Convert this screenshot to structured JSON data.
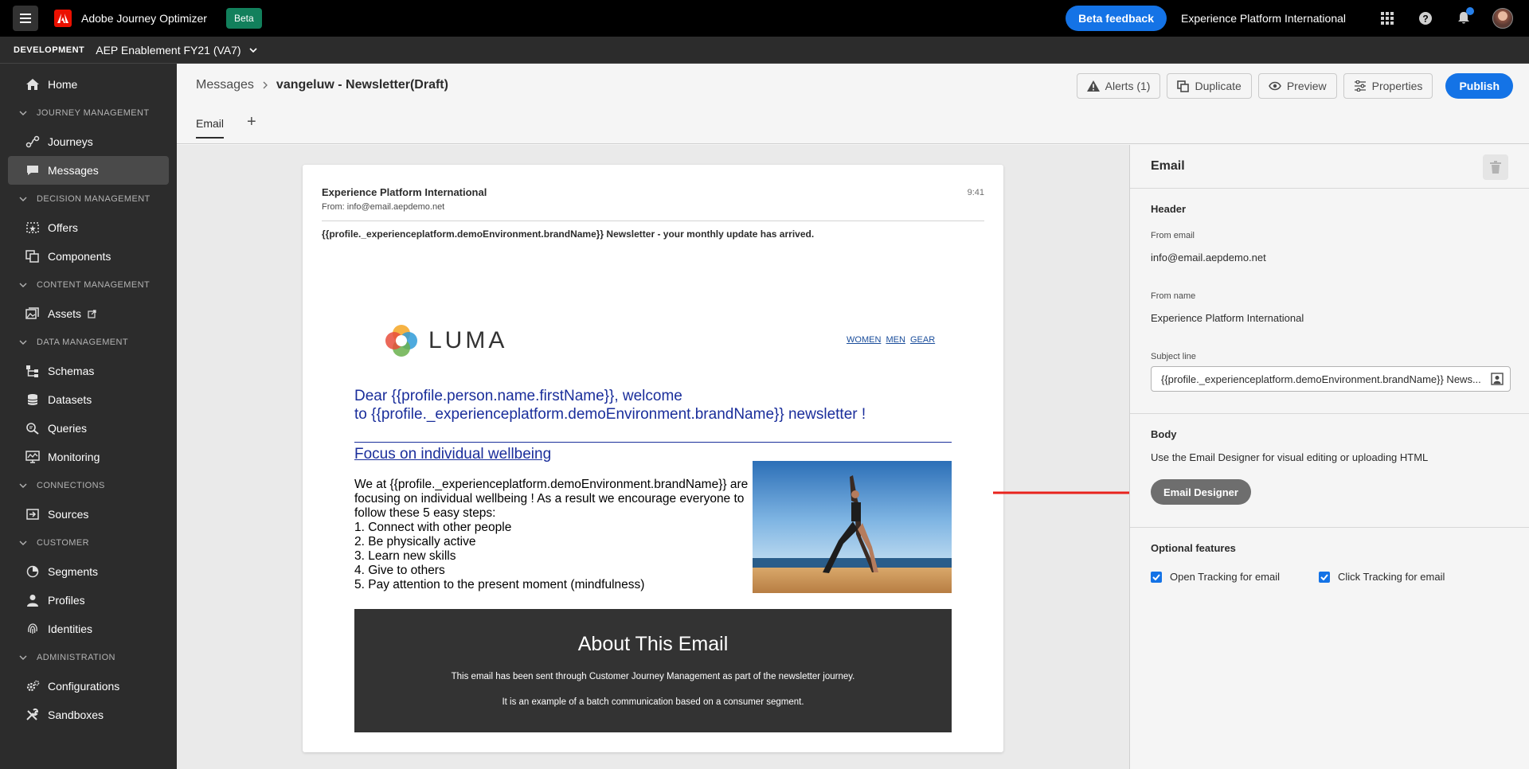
{
  "topbar": {
    "app_title": "Adobe Journey Optimizer",
    "beta_badge": "Beta",
    "beta_feedback": "Beta feedback",
    "org_name": "Experience Platform International"
  },
  "sandbox": {
    "env_label": "DEVELOPMENT",
    "name": "AEP Enablement FY21 (VA7)"
  },
  "sidebar": {
    "home": "Home",
    "journey_management": "JOURNEY MANAGEMENT",
    "journeys": "Journeys",
    "messages": "Messages",
    "decision_management": "DECISION MANAGEMENT",
    "offers": "Offers",
    "components": "Components",
    "content_management": "CONTENT MANAGEMENT",
    "assets": "Assets",
    "data_management": "DATA MANAGEMENT",
    "schemas": "Schemas",
    "datasets": "Datasets",
    "queries": "Queries",
    "monitoring": "Monitoring",
    "connections": "CONNECTIONS",
    "sources": "Sources",
    "customer": "CUSTOMER",
    "segments": "Segments",
    "profiles": "Profiles",
    "identities": "Identities",
    "administration": "ADMINISTRATION",
    "configurations": "Configurations",
    "sandboxes": "Sandboxes"
  },
  "header": {
    "breadcrumb_parent": "Messages",
    "breadcrumb_current": "vangeluw - Newsletter(Draft)",
    "tab_email": "Email",
    "alerts": "Alerts (1)",
    "duplicate": "Duplicate",
    "preview": "Preview",
    "properties": "Properties",
    "publish": "Publish"
  },
  "email_preview": {
    "sender": "Experience Platform International",
    "from": "From: info@email.aepdemo.net",
    "time": "9:41",
    "subject": "{{profile._experienceplatform.demoEnvironment.brandName}} Newsletter - your monthly update has arrived.",
    "logo_text": "LUMA",
    "nav_women": "WOMEN",
    "nav_men": "MEN",
    "nav_gear": "GEAR",
    "dear_line1": "Dear {{profile.person.name.firstName}}, welcome",
    "dear_line2": "to {{profile._experienceplatform.demoEnvironment.brandName}} newsletter !",
    "focus_heading": "Focus on individual wellbeing ",
    "body_intro": "We at {{profile._experienceplatform.demoEnvironment.brandName}} are focusing on individual wellbeing ! As a result we encourage everyone to follow these 5 easy steps:",
    "steps": [
      "1. Connect with other people",
      "2. Be physically active",
      "3. Learn new skills",
      "4. Give to others",
      "5. Pay attention to the present moment (mindfulness)"
    ],
    "about_title": "About This Email",
    "about_line1": "This email has been sent through Customer Journey Management as part of the newsletter journey.",
    "about_line2": "It is an example of a batch communication based on a consumer segment."
  },
  "panel": {
    "title": "Email",
    "header_section": "Header",
    "from_email_label": "From email",
    "from_email_value": "info@email.aepdemo.net",
    "from_name_label": "From name",
    "from_name_value": "Experience Platform International",
    "subject_label": "Subject line",
    "subject_value": "{{profile._experienceplatform.demoEnvironment.brandName}} News...",
    "body_section": "Body",
    "body_desc": "Use the Email Designer for visual editing or uploading HTML",
    "email_designer_button": "Email Designer",
    "optional_section": "Optional features",
    "open_tracking": "Open Tracking for email",
    "click_tracking": "Click Tracking for email"
  },
  "colors": {
    "accent": "#1473e6",
    "sidebar_bg": "#2c2c2c",
    "beta_green": "#12805c",
    "arrow_red": "#e8231d",
    "email_blue": "#1a2e9b"
  }
}
